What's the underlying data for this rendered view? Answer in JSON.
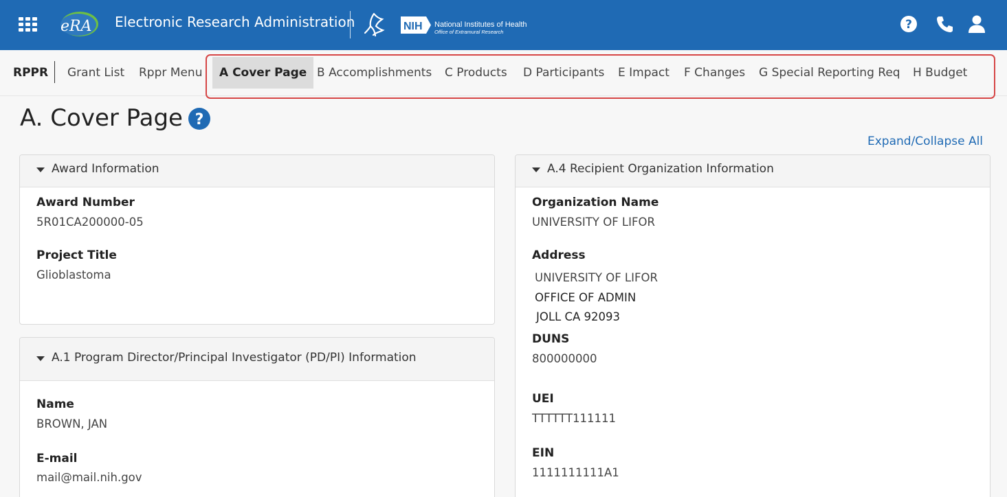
{
  "header": {
    "app_logo": "eRA",
    "app_title": "Electronic Research Administration",
    "agency_logo_text": "NIH",
    "agency_name": "National Institutes of Health",
    "agency_subname": "Office of Extramural Research",
    "colors": {
      "header_bg": "#1f6ab4",
      "accent": "#1f6ab4",
      "highlight_border": "#d64545"
    },
    "icons": [
      "apps-grid-icon",
      "help-icon",
      "phone-icon",
      "user-icon"
    ]
  },
  "nav": {
    "brand": "RPPR",
    "items": [
      {
        "label": "Grant List"
      },
      {
        "label": "Rppr Menu"
      },
      {
        "label": "A Cover Page",
        "active": true
      },
      {
        "label": "B Accomplishments"
      },
      {
        "label": "C Products"
      },
      {
        "label": "D Participants"
      },
      {
        "label": "E Impact"
      },
      {
        "label": "F Changes"
      },
      {
        "label": "G Special Reporting Req"
      },
      {
        "label": "H Budget"
      }
    ]
  },
  "page": {
    "title": "A. Cover Page",
    "expand_collapse": "Expand/Collapse All"
  },
  "award_info": {
    "heading": "Award Information",
    "award_number_label": "Award Number",
    "award_number": "5R01CA200000-05",
    "project_title_label": "Project Title",
    "project_title": "Glioblastoma"
  },
  "pdpi_info": {
    "heading": "A.1 Program Director/Principal Investigator (PD/PI) Information",
    "name_label": "Name",
    "name": "BROWN, JAN",
    "email_label": "E-mail",
    "email": "mail@mail.nih.gov"
  },
  "recipient_org": {
    "heading": "A.4 Recipient Organization Information",
    "org_name_label": "Organization Name",
    "org_name": "UNIVERSITY OF LIFOR",
    "address_label": "Address",
    "address_line1": "UNIVERSITY OF LIFOR",
    "address_line2": "OFFICE OF ADMIN",
    "address_line3": "JOLL CA 92093",
    "duns_label": "DUNS",
    "duns": "800000000",
    "uei_label": "UEI",
    "uei": "TTTTTT111111",
    "ein_label": "EIN",
    "ein": "1111111111A1"
  }
}
